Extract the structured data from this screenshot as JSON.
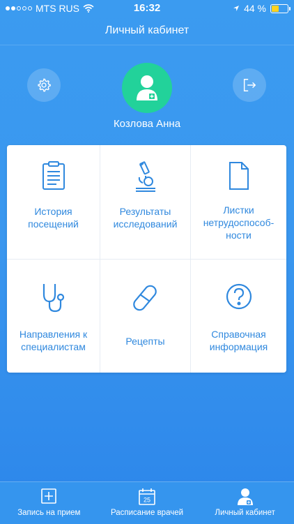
{
  "status_bar": {
    "carrier": "MTS RUS",
    "time": "16:32",
    "battery_percent_label": "44 %",
    "battery_level": 0.44
  },
  "header": {
    "title": "Личный кабинет"
  },
  "profile": {
    "name": "Козлова Анна",
    "settings_icon": "gear-icon",
    "logout_icon": "logout-icon",
    "avatar_icon": "doctor-avatar-icon"
  },
  "menu": {
    "items": [
      {
        "label": "История\nпосещений",
        "icon": "clipboard-icon"
      },
      {
        "label": "Результаты\nисследований",
        "icon": "microscope-icon"
      },
      {
        "label": "Листки\nнетрудоспособ-\nности",
        "icon": "document-icon"
      },
      {
        "label": "Направления к\nспециалистам",
        "icon": "stethoscope-icon"
      },
      {
        "label": "Рецепты",
        "icon": "pill-icon"
      },
      {
        "label": "Справочная\nинформация",
        "icon": "question-icon"
      }
    ]
  },
  "tabbar": {
    "tabs": [
      {
        "label": "Запись на прием",
        "icon": "plus-square-icon"
      },
      {
        "label": "Расписание врачей",
        "icon": "calendar-icon",
        "calendar_day": "25"
      },
      {
        "label": "Личный кабинет",
        "icon": "profile-icon",
        "selected": true
      }
    ]
  },
  "colors": {
    "accent_blue": "#2f88de",
    "avatar_green": "#22d29a",
    "battery_yellow": "#ffd21f"
  }
}
